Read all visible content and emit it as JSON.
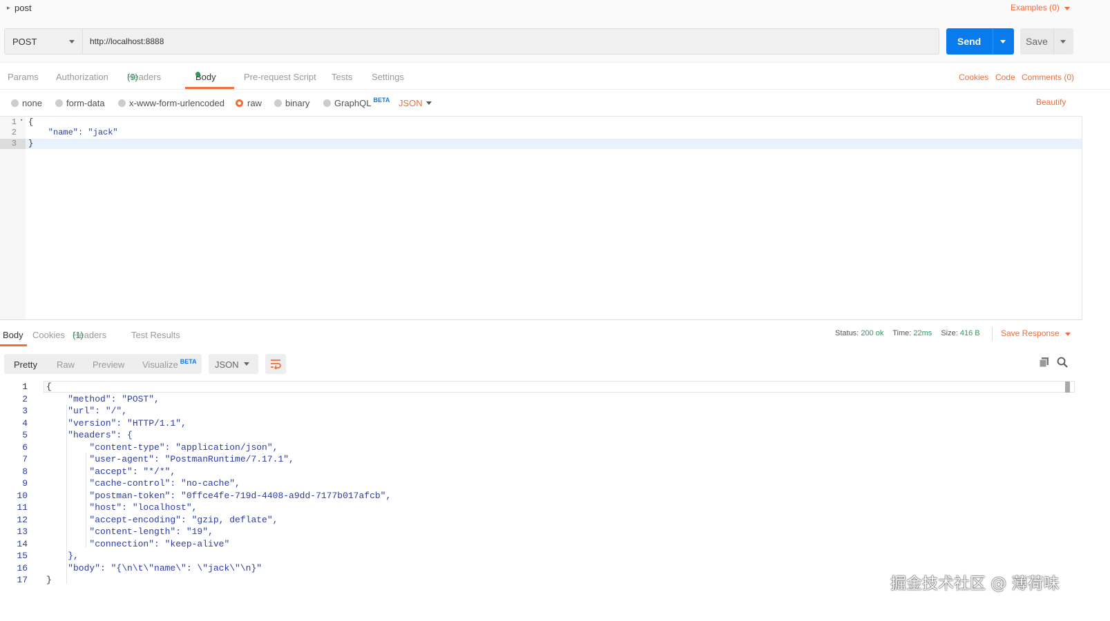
{
  "request": {
    "name": "post",
    "examples_label": "Examples (0)",
    "method": "POST",
    "url": "http://localhost:8888",
    "send_label": "Send",
    "save_label": "Save"
  },
  "request_tabs": {
    "params": "Params",
    "authorization": "Authorization",
    "headers": "Headers",
    "headers_count": "(9)",
    "body": "Body",
    "pre_request": "Pre-request Script",
    "tests": "Tests",
    "settings": "Settings",
    "cookies": "Cookies",
    "code": "Code",
    "comments": "Comments (0)"
  },
  "body_types": {
    "none": "none",
    "form_data": "form-data",
    "urlencoded": "x-www-form-urlencoded",
    "raw": "raw",
    "binary": "binary",
    "graphql": "GraphQL",
    "beta": "BETA",
    "format": "JSON",
    "beautify": "Beautify",
    "selected": "raw"
  },
  "request_editor": {
    "line_numbers": [
      "1",
      "2",
      "3"
    ],
    "lines": [
      "{",
      "    \"name\": \"jack\"",
      "}"
    ]
  },
  "response_tabs": {
    "body": "Body",
    "cookies": "Cookies",
    "headers": "Headers",
    "headers_count": "(1)",
    "test_results": "Test Results"
  },
  "response_status": {
    "status_label": "Status:",
    "status_value": "200 ok",
    "time_label": "Time:",
    "time_value": "22ms",
    "size_label": "Size:",
    "size_value": "416 B",
    "save_response": "Save Response"
  },
  "response_view": {
    "pretty": "Pretty",
    "raw": "Raw",
    "preview": "Preview",
    "visualize": "Visualize",
    "beta": "BETA",
    "format": "JSON"
  },
  "response_editor": {
    "line_numbers": [
      "1",
      "2",
      "3",
      "4",
      "5",
      "6",
      "7",
      "8",
      "9",
      "10",
      "11",
      "12",
      "13",
      "14",
      "15",
      "16",
      "17"
    ],
    "lines": [
      "{",
      "    \"method\": \"POST\",",
      "    \"url\": \"/\",",
      "    \"version\": \"HTTP/1.1\",",
      "    \"headers\": {",
      "        \"content-type\": \"application/json\",",
      "        \"user-agent\": \"PostmanRuntime/7.17.1\",",
      "        \"accept\": \"*/*\",",
      "        \"cache-control\": \"no-cache\",",
      "        \"postman-token\": \"0ffce4fe-719d-4408-a9dd-7177b017afcb\",",
      "        \"host\": \"localhost\",",
      "        \"accept-encoding\": \"gzip, deflate\",",
      "        \"content-length\": \"19\",",
      "        \"connection\": \"keep-alive\"",
      "    },",
      "    \"body\": \"{\\n\\t\\\"name\\\": \\\"jack\\\"\\n}\"",
      "}"
    ]
  },
  "watermark": "掘金技术社区 @ 薄荷味",
  "colors": {
    "accent": "#f26b3a",
    "send_button": "#097bed",
    "status_green": "#2b9a5b"
  }
}
